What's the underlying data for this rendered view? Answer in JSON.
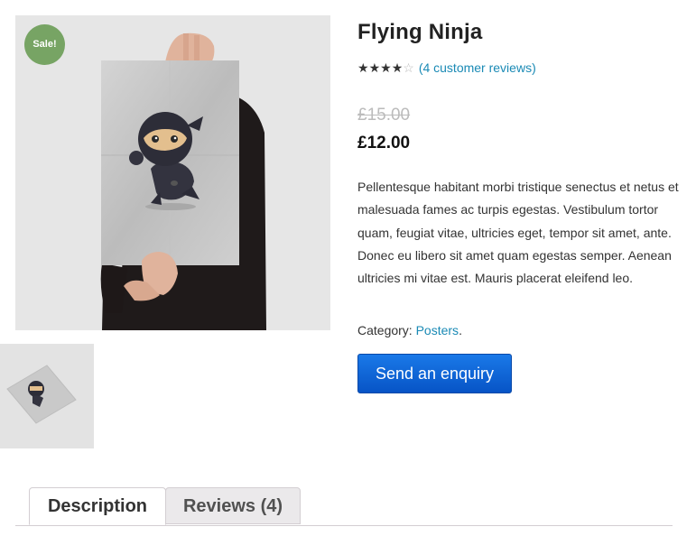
{
  "badge": {
    "sale": "Sale!"
  },
  "product": {
    "title": "Flying Ninja",
    "rating_value": 4,
    "rating_max": 5,
    "reviews_link": "(4 customer reviews)",
    "regular_price": "£15.00",
    "sale_price": "£12.00",
    "description": "Pellentesque habitant morbi tristique senectus et netus et malesuada fames ac turpis egestas. Vestibulum tortor quam, feugiat vitae, ultricies eget, tempor sit amet, ante. Donec eu libero sit amet quam egestas semper. Aenean ultricies mi vitae est. Mauris placerat eleifend leo.",
    "category_label": "Category:",
    "category_value": "Posters",
    "category_suffix": "."
  },
  "enquiry_button": "Send an enquiry",
  "tabs": [
    {
      "label": "Description",
      "active": true
    },
    {
      "label": "Reviews (4)",
      "active": false
    }
  ],
  "colors": {
    "sale_badge": "#77a464",
    "link": "#1a8ab5",
    "button": "#0754c6"
  }
}
